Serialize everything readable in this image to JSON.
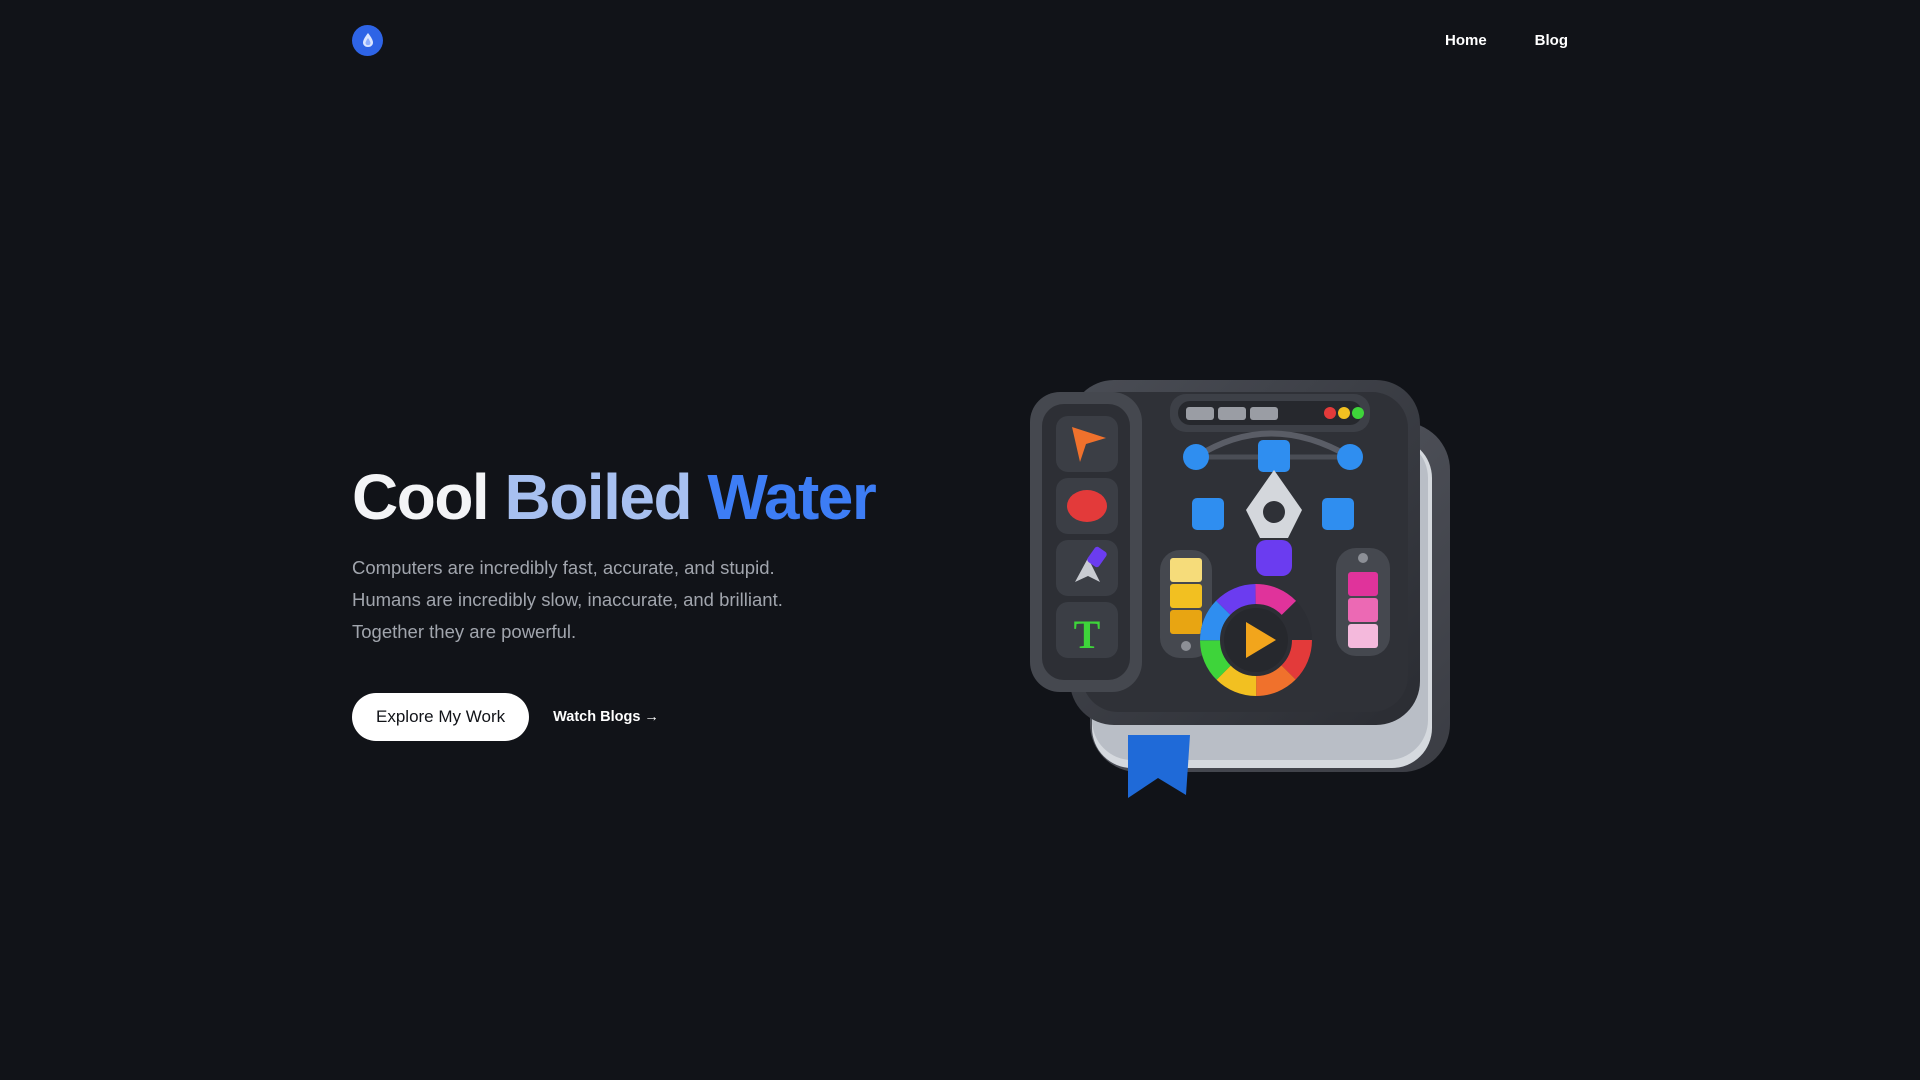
{
  "header": {
    "logo_icon": "water-drop-icon",
    "nav": [
      {
        "label": "Home"
      },
      {
        "label": "Blog"
      }
    ]
  },
  "hero": {
    "title_parts": [
      "Cool",
      "Boiled",
      "Water"
    ],
    "title_colors": [
      "#f3f4f6",
      "#a7c0f0",
      "#3d7df5"
    ],
    "description_lines": [
      "Computers are incredibly fast, accurate, and stupid.",
      "Humans are incredibly slow, inaccurate, and brilliant.",
      "Together they are powerful."
    ],
    "primary_button": "Explore My Work",
    "secondary_link": "Watch Blogs →"
  },
  "illustration": {
    "icon": "design-toolbook-icon"
  },
  "colors": {
    "background": "#111318",
    "accent": "#2e64e6"
  }
}
